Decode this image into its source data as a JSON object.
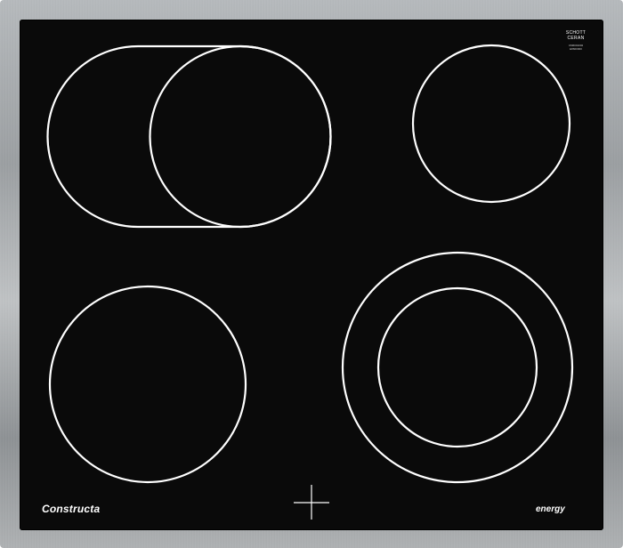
{
  "product": {
    "brand": "Constructa",
    "energy_label": "energy",
    "glass_maker_line1": "SCHOTT",
    "glass_maker_line2": "CERAN",
    "glass_code_line1": "CM6001002",
    "glass_code_line2": "E8600000"
  },
  "zones": [
    {
      "name": "rear-left-extended-zone",
      "type": "dual-oval"
    },
    {
      "name": "rear-right-zone",
      "type": "single"
    },
    {
      "name": "front-left-zone",
      "type": "single"
    },
    {
      "name": "front-right-zone",
      "type": "dual-ring"
    }
  ],
  "colors": {
    "glass": "#0a0a0a",
    "frame": "#a8acaf",
    "markings": "#ffffff"
  }
}
